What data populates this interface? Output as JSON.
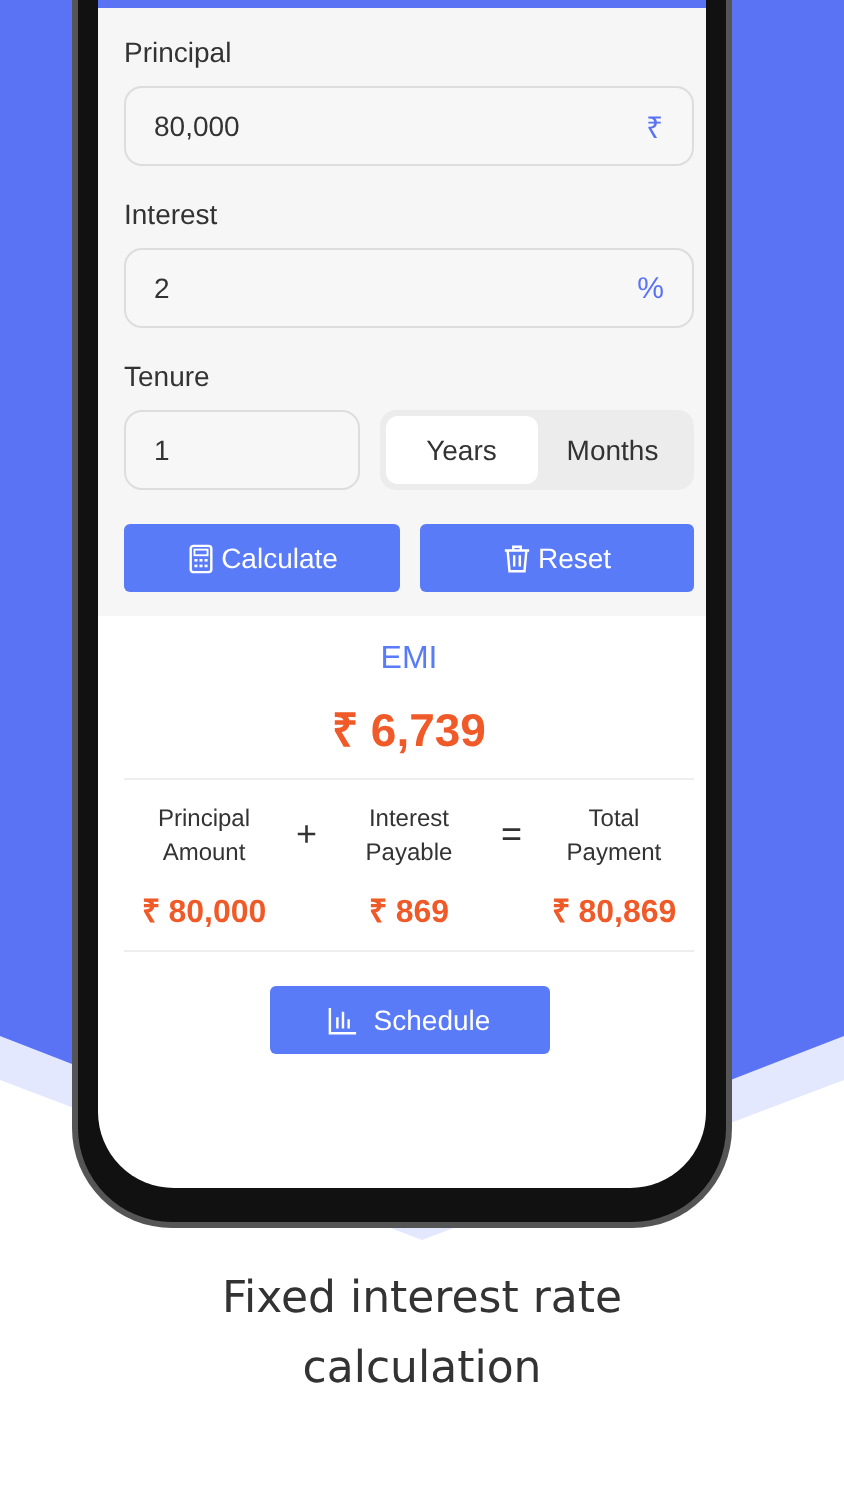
{
  "form": {
    "fields": [
      {
        "label": "Principal",
        "value": "80,000",
        "suffix": "₹"
      },
      {
        "label": "Interest",
        "value": "2",
        "suffix": "%"
      }
    ],
    "tenure": {
      "label": "Tenure",
      "value": "1",
      "units": [
        {
          "label": "Years",
          "selected": true
        },
        {
          "label": "Months",
          "selected": false
        }
      ]
    },
    "buttons": [
      {
        "kind": "calculate",
        "label": "Calculate"
      },
      {
        "kind": "reset",
        "label": "Reset"
      }
    ]
  },
  "result": {
    "title": "EMI",
    "amount": "₹ 6,739",
    "breakdown": [
      {
        "kind": "value",
        "label": "Principal Amount",
        "amount": "₹ 80,000"
      },
      {
        "kind": "operator",
        "symbol": "+"
      },
      {
        "kind": "value",
        "label": "Interest Payable",
        "amount": "₹ 869"
      },
      {
        "kind": "operator",
        "symbol": "="
      },
      {
        "kind": "value",
        "label": "Total Payment",
        "amount": "₹ 80,869"
      }
    ],
    "schedule_button": "Schedule"
  },
  "caption": "Fixed interest rate calculation"
}
